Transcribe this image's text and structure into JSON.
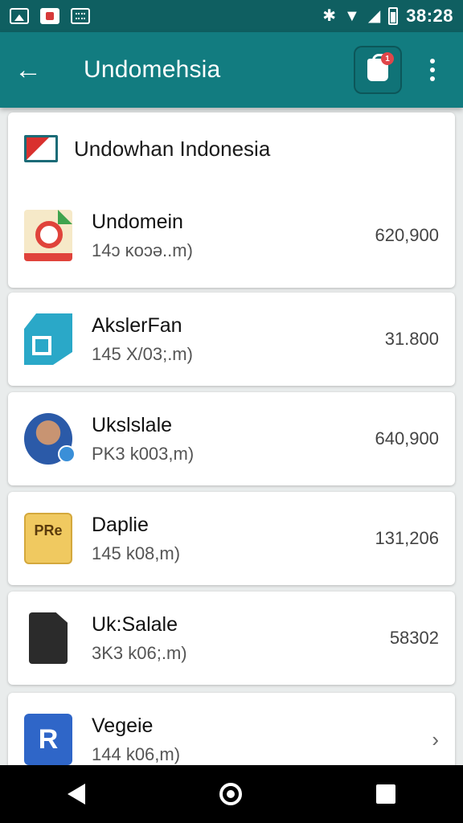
{
  "status_bar": {
    "time": "38:28",
    "icons": [
      "image-icon",
      "notification-icon",
      "keyboard-icon",
      "vibrate-icon",
      "wifi-icon",
      "signal-icon",
      "battery-icon"
    ],
    "colors": {
      "background": "#0f5f61"
    }
  },
  "app_bar": {
    "title": "Undomehsia",
    "badge_count": "1",
    "colors": {
      "background": "#127c80",
      "badge": "#e0464a"
    }
  },
  "section": {
    "title": "Undowhan Indonesia"
  },
  "items": [
    {
      "name": "Undomein",
      "subtitle": "14ɔ ĸoɔə..m)",
      "value": "620,900",
      "icon": "document-app-icon"
    },
    {
      "name": "AkslerFan",
      "subtitle": "145 X/03;.m)",
      "value": "31.800",
      "icon": "maps-app-icon"
    },
    {
      "name": "Ukslslale",
      "subtitle": "PK3 k003,m)",
      "value": "640,900",
      "icon": "profile-avatar-icon"
    },
    {
      "name": "Daplie",
      "icon_text": "PRe",
      "subtitle": "145 k08,m)",
      "value": "131,206",
      "icon": "prb-app-icon"
    },
    {
      "name": "Uk:Salale",
      "subtitle": "3K3 k06;.m)",
      "value": "58302",
      "icon": "dark-document-icon"
    },
    {
      "name": "Vegeie",
      "icon_text": "R",
      "subtitle": "144 k06,m)",
      "value": "",
      "icon": "r-app-icon"
    }
  ],
  "nav_bar": {
    "icons": [
      "back-icon",
      "home-icon",
      "recents-icon"
    ]
  }
}
